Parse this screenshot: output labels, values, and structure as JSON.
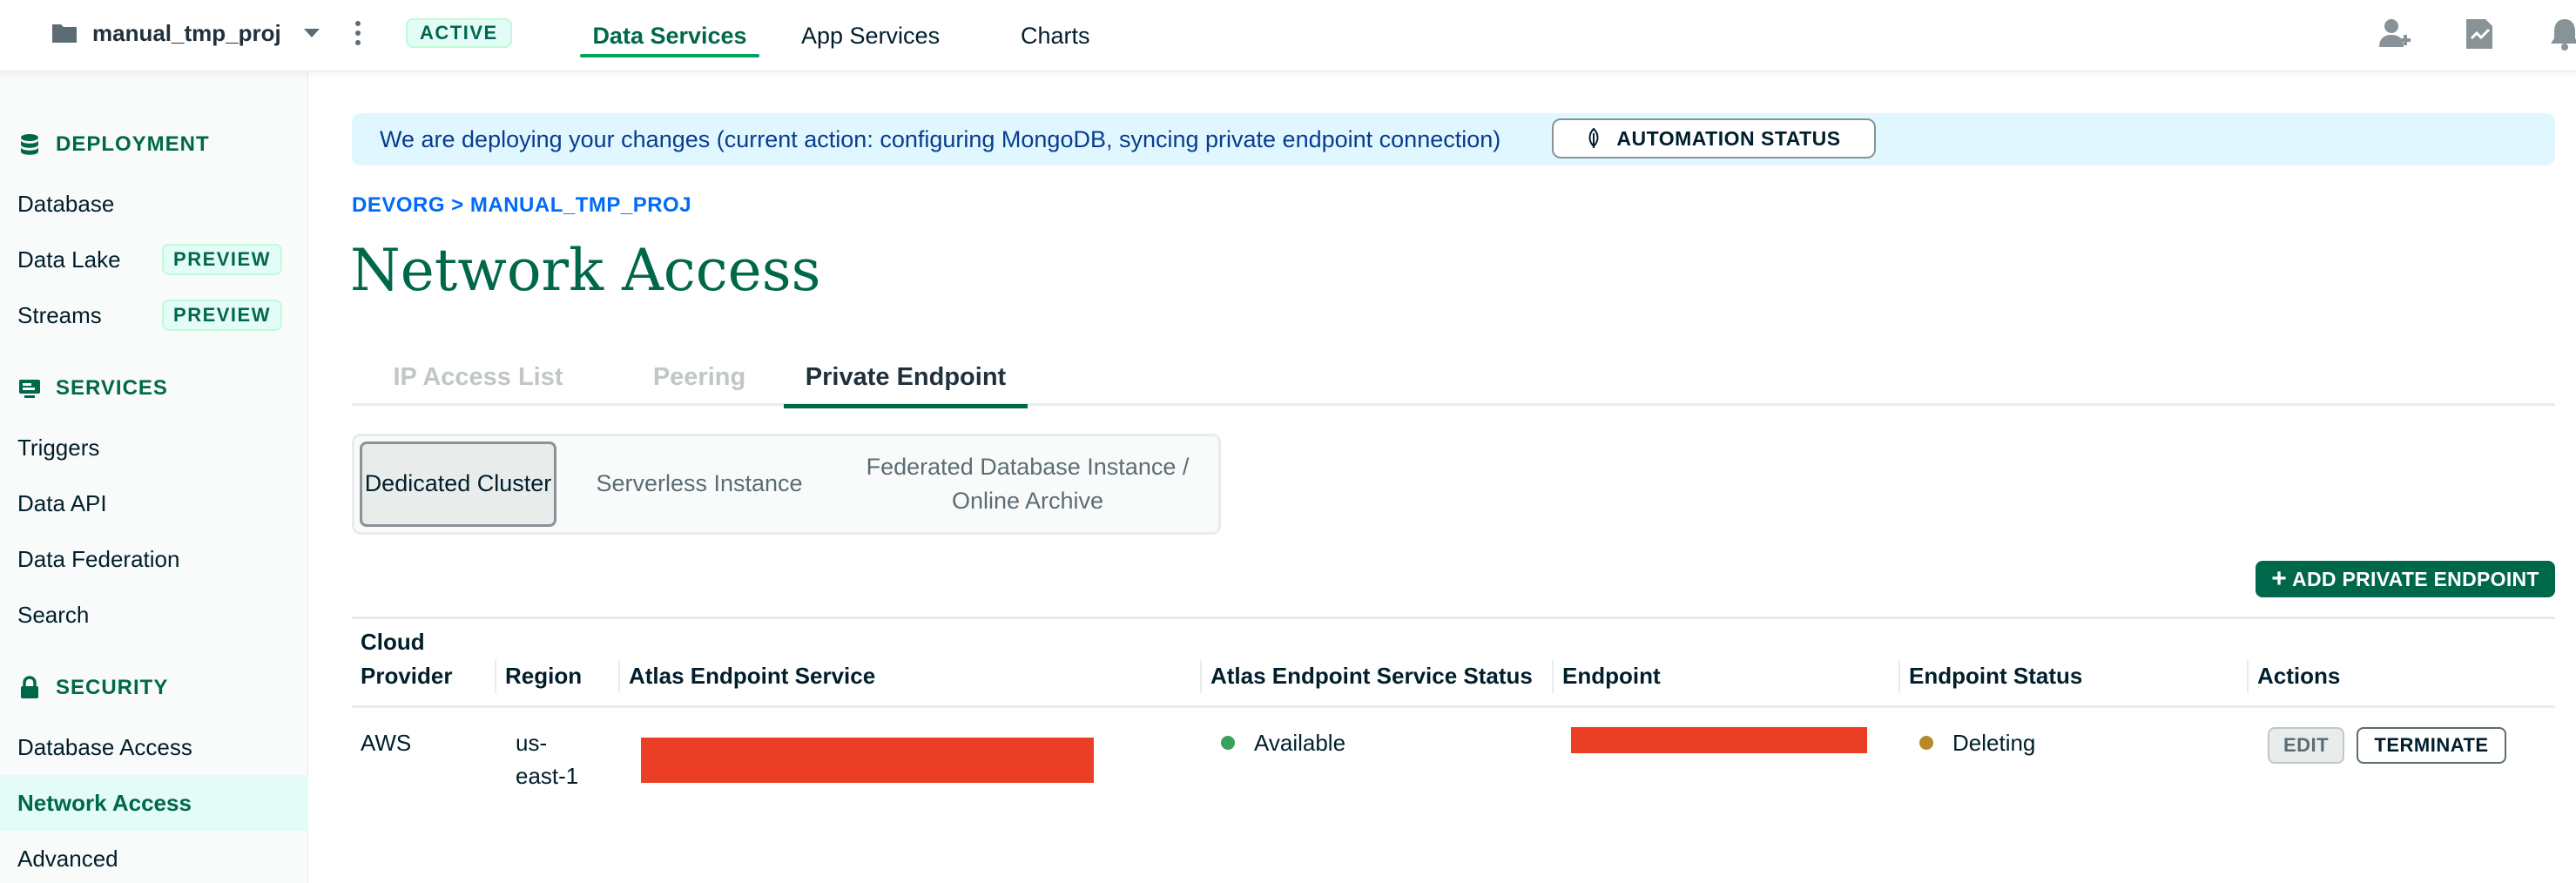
{
  "topbar": {
    "project_name": "manual_tmp_proj",
    "status_badge": "ACTIVE",
    "nav": [
      "Data Services",
      "App Services",
      "Charts"
    ]
  },
  "sidebar": {
    "deployment_heading": "DEPLOYMENT",
    "deployment_items": [
      {
        "label": "Database"
      },
      {
        "label": "Data Lake",
        "badge": "PREVIEW"
      },
      {
        "label": "Streams",
        "badge": "PREVIEW"
      }
    ],
    "services_heading": "SERVICES",
    "services_items": [
      "Triggers",
      "Data API",
      "Data Federation",
      "Search"
    ],
    "security_heading": "SECURITY",
    "security_items": [
      "Database Access",
      "Network Access",
      "Advanced"
    ]
  },
  "banner": {
    "message": "We are deploying your changes (current action: configuring MongoDB, syncing private endpoint connection)",
    "button_label": "AUTOMATION STATUS"
  },
  "breadcrumb": "DEVORG > MANUAL_TMP_PROJ",
  "page_title": "Network Access",
  "tabs": [
    "IP Access List",
    "Peering",
    "Private Endpoint"
  ],
  "segmented": {
    "options": [
      "Dedicated Cluster",
      "Serverless Instance",
      "Federated Database Instance / Online Archive"
    ],
    "selected": "Dedicated Cluster"
  },
  "add_button_label": "ADD PRIVATE ENDPOINT",
  "table": {
    "headers": {
      "cloud_provider_1": "Cloud",
      "cloud_provider_2": "Provider",
      "region": "Region",
      "endpoint_service": "Atlas Endpoint Service",
      "service_status": "Atlas Endpoint Service Status",
      "endpoint": "Endpoint",
      "endpoint_status": "Endpoint Status",
      "actions": "Actions"
    },
    "rows": [
      {
        "cloud_provider": "AWS",
        "region_1": "us-",
        "region_2": "east-1",
        "service_status": "Available",
        "endpoint_status": "Deleting",
        "edit_label": "EDIT",
        "terminate_label": "TERMINATE"
      }
    ]
  },
  "colors": {
    "brand_green": "#00684a",
    "available_dot": "#3aa05a",
    "deleting_dot": "#b8892a",
    "redaction": "#ea3f24",
    "banner_bg": "#e1f7ff"
  }
}
